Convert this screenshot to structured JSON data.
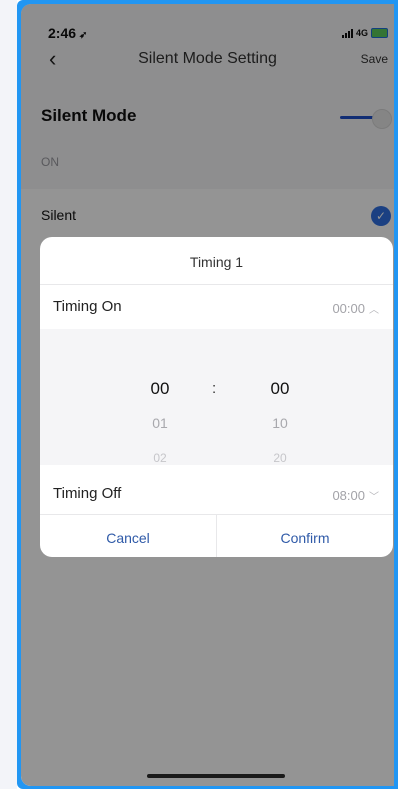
{
  "status_bar": {
    "time": "2:46",
    "network": "4G"
  },
  "nav": {
    "title": "Silent Mode Setting",
    "save_label": "Save"
  },
  "silent_mode": {
    "title": "Silent Mode",
    "state": "ON",
    "enabled": true
  },
  "list": {
    "silent_label": "Silent",
    "silent_checked": true
  },
  "dialog": {
    "title": "Timing 1",
    "timing_on": {
      "label": "Timing On",
      "value": "00:00"
    },
    "timing_off": {
      "label": "Timing Off",
      "value": "08:00"
    },
    "picker": {
      "hours": {
        "selected": "00",
        "next": "01",
        "after": "02"
      },
      "separator": ":",
      "minutes": {
        "selected": "00",
        "next": "10",
        "after": "20"
      }
    },
    "cancel_label": "Cancel",
    "confirm_label": "Confirm"
  },
  "colors": {
    "accent": "#2f6fe0",
    "frame": "#2196f3",
    "button_text": "#2f5aa8"
  }
}
